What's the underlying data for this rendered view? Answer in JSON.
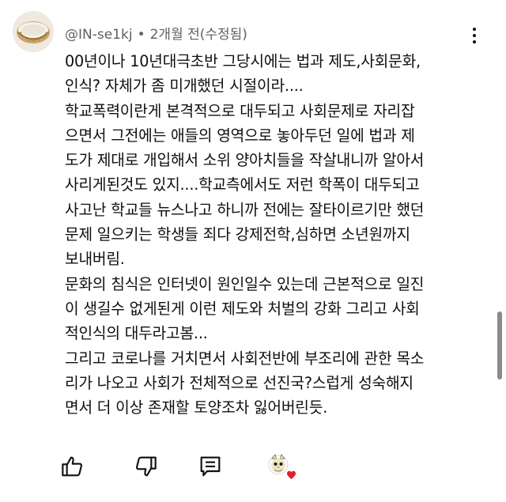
{
  "comment": {
    "author": "@IN-se1kj",
    "separator": "•",
    "time": "2개월 전(수정됨)",
    "lines": [
      "00년이나 10년대극초반 그당시에는 법과 제도,사회문화,",
      "인식? 자체가 좀 미개했던 시절이라....",
      "학교폭력이란게 본격적으로 대두되고 사회문제로 자리잡",
      "으면서 그전에는 애들의 영역으로 놓아두던 일에 법과 제",
      "도가 제대로 개입해서 소위 양아치들을 작살내니까 알아서",
      "사리게된것도 있지....학교측에서도 저런 학폭이 대두되고",
      "사고난 학교들 뉴스나고 하니까 전에는 잘타이르기만 했던",
      "문제 일으키는 학생들 죄다 강제전학,심하면 소년원까지",
      "보내버림.",
      "문화의 침식은 인터넷이 원인일수 있는데 근본적으로 일진",
      "이 생길수 없게된게 이런 제도와 처벌의 강화 그리고 사회",
      "적인식의 대두라고봄...",
      "그리고 코로나를 거치면서 사회전반에 부조리에 관한 목소",
      "리가 나오고 사회가 전체적으로 선진국?스럽게 성숙해지",
      "면서 더 이상 존재할 토양조차 잃어버린듯."
    ]
  },
  "actions": {
    "like_icon": "thumbs-up-icon",
    "dislike_icon": "thumbs-down-icon",
    "reply_icon": "reply-comment-icon",
    "creator_heart_icon": "creator-heart-icon"
  },
  "colors": {
    "text": "#0f0f0f",
    "meta": "#606060",
    "heart": "#e0202a"
  }
}
